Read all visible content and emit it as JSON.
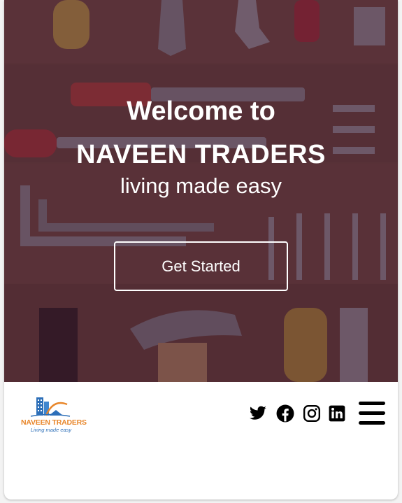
{
  "hero": {
    "welcome": "Welcome to",
    "brand": "NAVEEN TRADERS",
    "tagline": "living made easy",
    "cta_label": "Get Started"
  },
  "navbar": {
    "logo": {
      "name": "NAVEEN TRADERS",
      "tagline": "Living made easy"
    },
    "social": [
      "twitter-icon",
      "facebook-icon",
      "instagram-icon",
      "linkedin-icon"
    ],
    "menu_icon": "hamburger-menu-icon"
  },
  "colors": {
    "overlay": "#3c142d",
    "logo_orange": "#e8862a",
    "logo_blue": "#2d6fb8"
  }
}
